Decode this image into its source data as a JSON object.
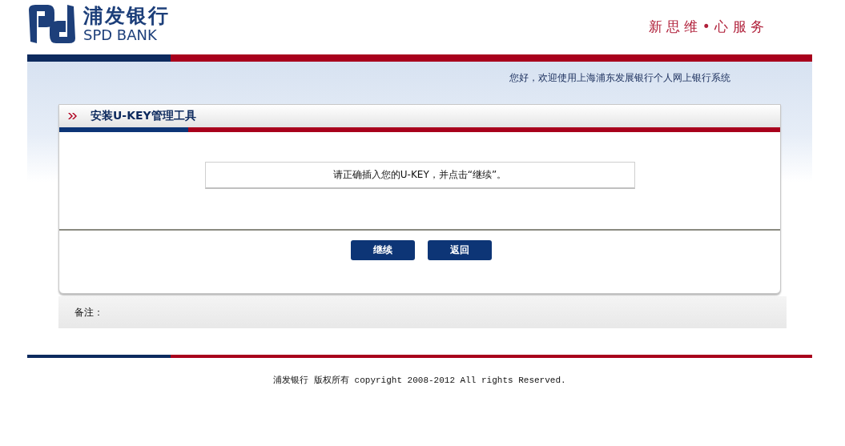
{
  "header": {
    "bank_name": "浦发银行",
    "bank_name_en": "SPD BANK",
    "slogan": "新 思 维 • 心 服 务"
  },
  "welcome": "您好，欢迎使用上海浦东发展银行个人网上银行系统",
  "panel": {
    "title": "安装U-KEY管理工具",
    "message": "请正确插入您的U-KEY，并点击“继续”。",
    "buttons": [
      {
        "label": "继续"
      },
      {
        "label": "返回"
      }
    ]
  },
  "note_label": "备注：",
  "footer": {
    "copyright": "浦发银行 版权所有 copyright 2008-2012 All rights Reserved."
  }
}
